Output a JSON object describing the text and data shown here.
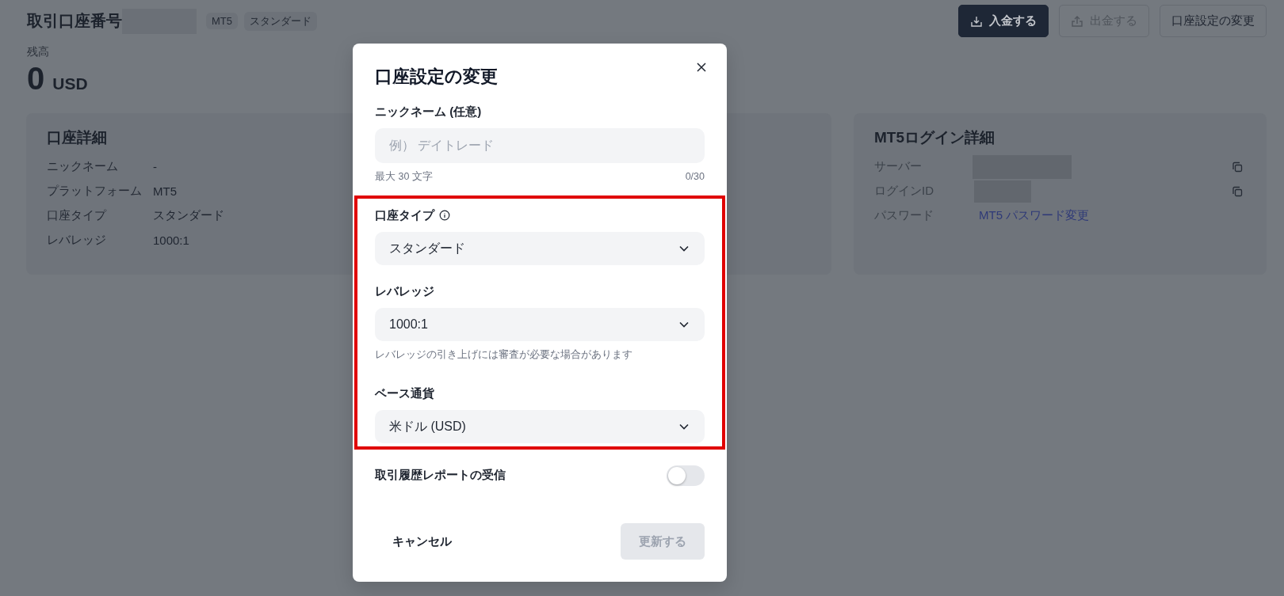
{
  "header": {
    "title": "取引口座番号",
    "tags": [
      "MT5",
      "スタンダード"
    ],
    "buttons": [
      {
        "label": "入金する",
        "kind": "primary",
        "disabled": false
      },
      {
        "label": "出金する",
        "kind": "outline",
        "disabled": true
      },
      {
        "label": "口座設定の変更",
        "kind": "outline",
        "disabled": false
      }
    ]
  },
  "balance": {
    "label": "残高",
    "amount": "0",
    "currency": "USD"
  },
  "account_details": {
    "title": "口座詳細",
    "rows": [
      {
        "label": "ニックネーム",
        "value": "-"
      },
      {
        "label": "プラットフォーム",
        "value": "MT5"
      },
      {
        "label": "口座タイプ",
        "value": "スタンダード"
      },
      {
        "label": "レバレッジ",
        "value": "1000:1"
      }
    ]
  },
  "mt5_login": {
    "title": "MT5ログイン詳細",
    "rows": [
      {
        "label": "サーバー",
        "kind": "masked"
      },
      {
        "label": "ログインID",
        "kind": "masked"
      },
      {
        "label": "パスワード",
        "kind": "link",
        "value": "MT5 パスワード変更"
      }
    ]
  },
  "dialog": {
    "title": "口座設定の変更",
    "fields": [
      {
        "kind": "text",
        "label": "ニックネーム (任意)",
        "placeholder": "例） デイトレード",
        "hint": "最大 30 文字",
        "counter": "0/30",
        "highlighted": false,
        "info": false
      },
      {
        "kind": "select",
        "label": "口座タイプ",
        "value": "スタンダード",
        "highlighted": true,
        "info": true
      },
      {
        "kind": "select",
        "label": "レバレッジ",
        "value": "1000:1",
        "hint": "レバレッジの引き上げには審査が必要な場合があります",
        "highlighted": true,
        "info": false
      },
      {
        "kind": "select",
        "label": "ベース通貨",
        "value": "米ドル (USD)",
        "highlighted": true,
        "info": false
      }
    ],
    "toggle": {
      "label": "取引履歴レポートの受信",
      "on": false
    },
    "cancel": "キャンセル",
    "submit": {
      "label": "更新する",
      "disabled": true
    }
  }
}
